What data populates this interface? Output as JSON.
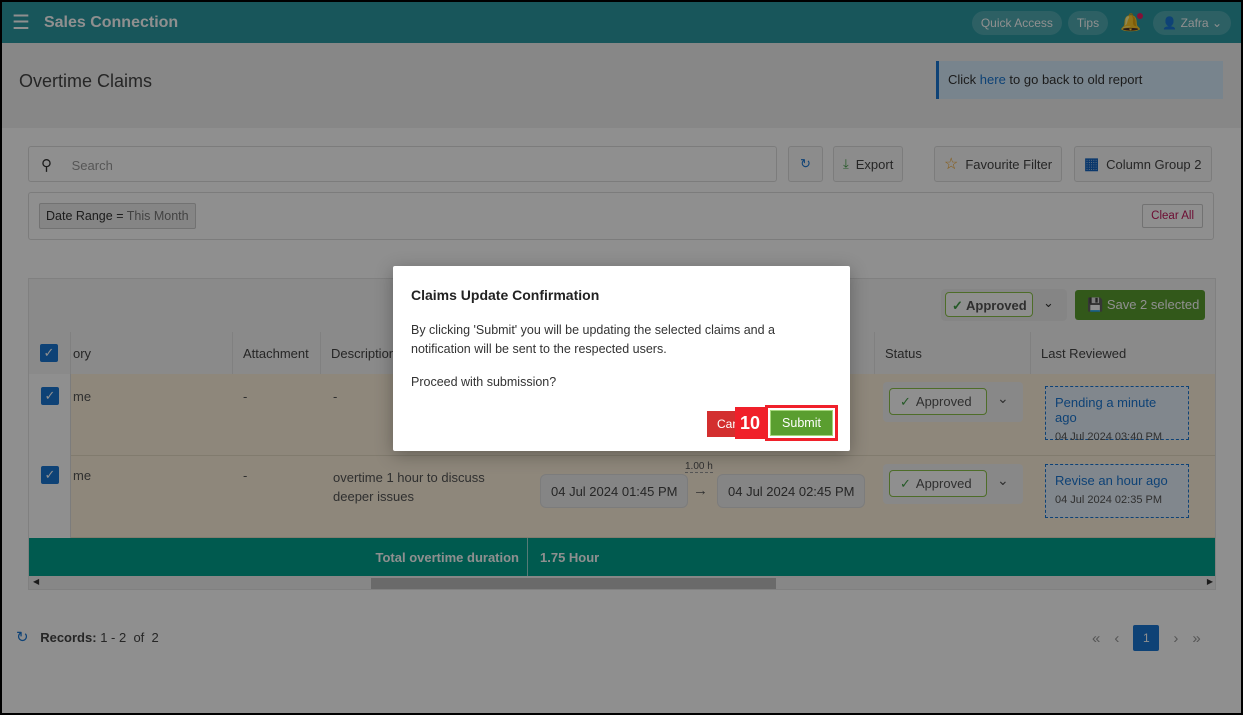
{
  "app": {
    "title": "Sales Connection",
    "quick_access": "Quick Access",
    "tips": "Tips",
    "user": "Zafra"
  },
  "page": {
    "title": "Overtime Claims",
    "notice_pre": "Click ",
    "notice_link": "here",
    "notice_post": " to go back to old report"
  },
  "toolbar": {
    "search_placeholder": "Search",
    "export": "Export",
    "favourite_filter": "Favourite Filter",
    "column_group": "Column Group 2"
  },
  "filters": {
    "chip_label": "Date Range",
    "chip_op": " = ",
    "chip_value": "This Month",
    "clear_all": "Clear All"
  },
  "bulk": {
    "status": "Approved",
    "save": "Save 2 selected"
  },
  "columns": [
    "ory",
    "Attachment",
    "Description",
    "Status",
    "Last Reviewed"
  ],
  "rows": [
    {
      "category": "me",
      "attachment": "-",
      "description": "-",
      "status": "Approved",
      "review_status": "Pending a minute ago",
      "review_time": "04 Jul 2024 03:40 PM"
    },
    {
      "category": "me",
      "attachment": "-",
      "description": "overtime 1 hour to discuss deeper issues",
      "duration": "1.00 h",
      "start": "04 Jul 2024 01:45 PM",
      "end": "04 Jul 2024 02:45 PM",
      "status": "Approved",
      "review_status": "Revise an hour ago",
      "review_time": "04 Jul 2024 02:35 PM"
    }
  ],
  "footer": {
    "label": "Total overtime duration",
    "value": "1.75 Hour"
  },
  "pagination": {
    "records_label": "Records:",
    "range": "1 - 2",
    "of": "of",
    "total": "2",
    "current_page": "1"
  },
  "modal": {
    "title": "Claims Update Confirmation",
    "message": "By clicking 'Submit' you will be updating the selected claims and a notification will be sent to the respected users.",
    "question": "Proceed with submission?",
    "cancel": "Cancel",
    "submit": "Submit"
  },
  "annotation": {
    "step": "10"
  },
  "colors": {
    "header": "#2b9aa3",
    "approved": "#43a047",
    "save": "#5a9e2f",
    "cancel": "#d32f2f",
    "link": "#1976d2"
  }
}
